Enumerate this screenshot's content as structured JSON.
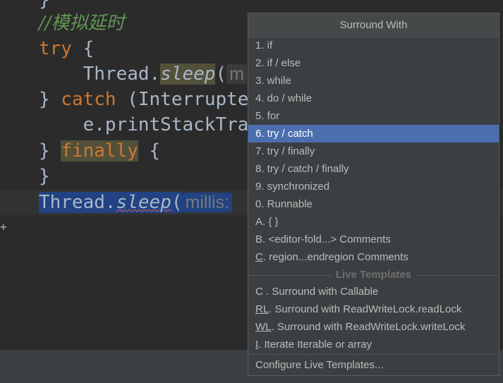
{
  "editor": {
    "lines": [
      {
        "text": "}"
      },
      {
        "comment": "//模拟延时"
      },
      {
        "kw": "try",
        "rest": " {"
      },
      {
        "pre": "    Thread.",
        "method": "sleep",
        "paren": "(",
        "hint": "m"
      },
      {
        "brace": "} ",
        "kw": "catch",
        "rest": " (Interrupte"
      },
      {
        "text": "    e.printStackTra"
      },
      {
        "brace": "} ",
        "kw": "finally",
        "rest": " {"
      },
      {
        "text": "}"
      },
      {
        "pre": "Thread.",
        "method": "sleep",
        "paren": "(",
        "hint": "millis:"
      }
    ]
  },
  "popup": {
    "title": "Surround With",
    "items": [
      {
        "key": "1",
        "label": ". if"
      },
      {
        "key": "2",
        "label": ". if / else"
      },
      {
        "key": "3",
        "label": ". while"
      },
      {
        "key": "4",
        "label": ". do / while"
      },
      {
        "key": "5",
        "label": ". for"
      },
      {
        "key": "6",
        "label": ". try / catch"
      },
      {
        "key": "7",
        "label": ". try / finally"
      },
      {
        "key": "8",
        "label": ". try / catch / finally"
      },
      {
        "key": "9",
        "label": ". synchronized"
      },
      {
        "key": "0",
        "label": ". Runnable"
      },
      {
        "key": "A",
        "label": ". { }"
      },
      {
        "key": "B",
        "label": ". <editor-fold...> Comments"
      },
      {
        "key": "C",
        "label": ". region...endregion Comments"
      }
    ],
    "selected_index": 5,
    "section_label": "Live Templates",
    "templates": [
      {
        "key": "C",
        "label": " . Surround with Callable"
      },
      {
        "key": "RL",
        "label": ". Surround with ReadWriteLock.readLock"
      },
      {
        "key": "WL",
        "label": ". Surround with ReadWriteLock.writeLock"
      },
      {
        "key": "I",
        "label": ". Iterate Iterable or array"
      }
    ],
    "footer": "Configure Live Templates..."
  }
}
